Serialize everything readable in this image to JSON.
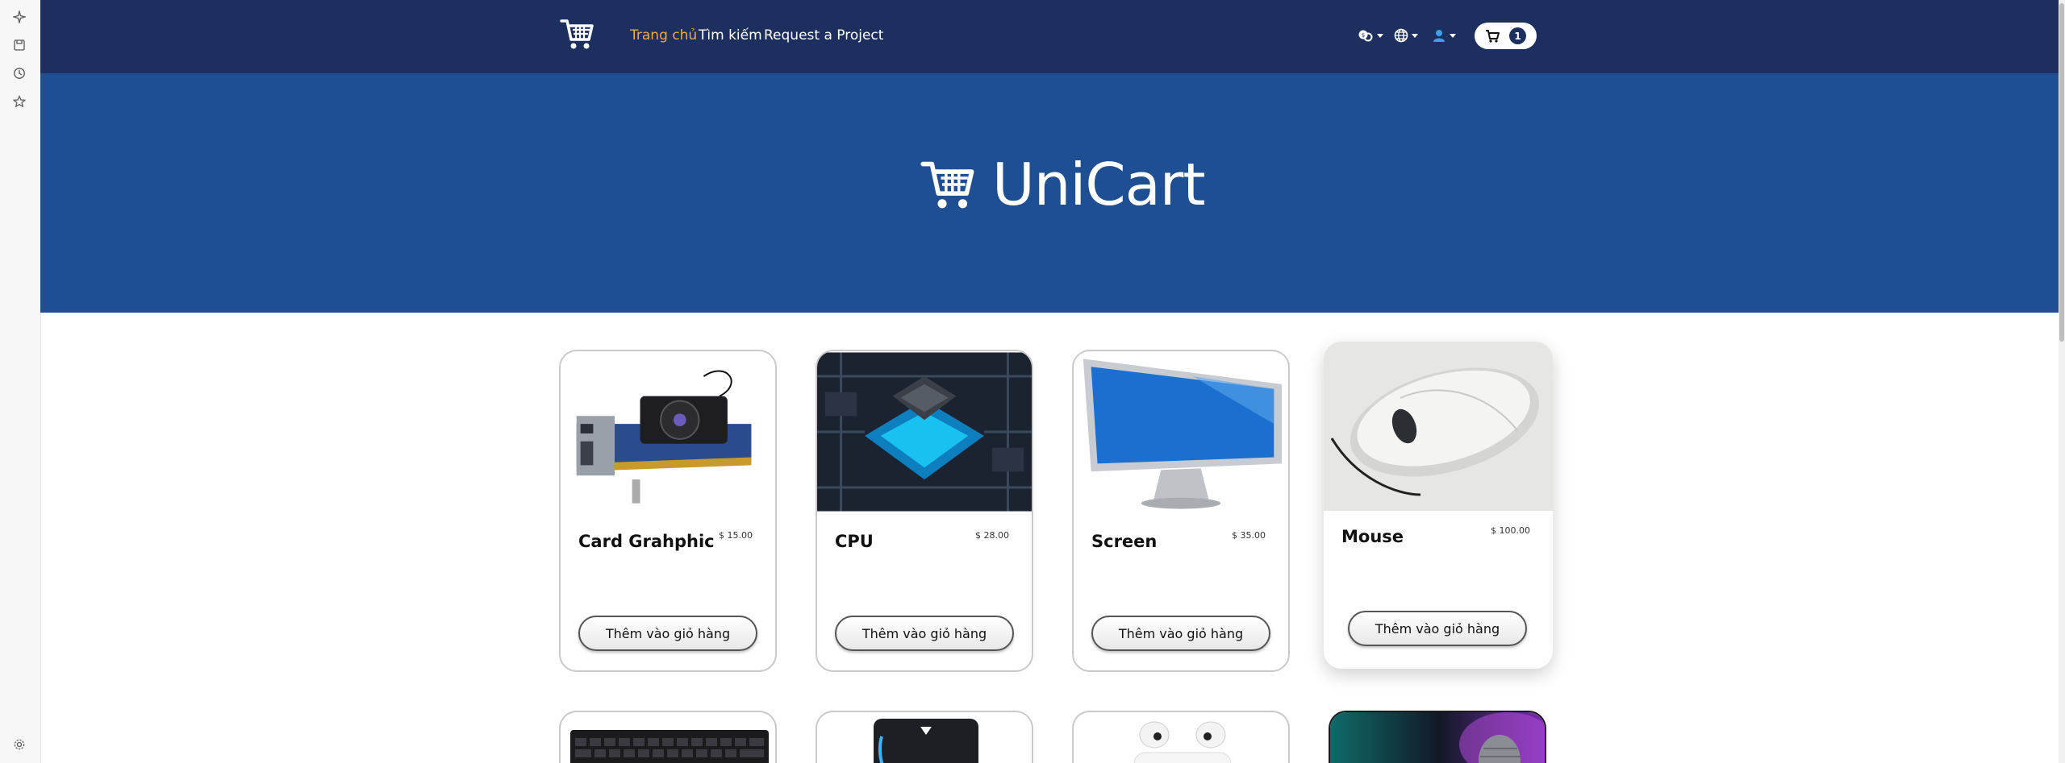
{
  "browser_rail": {
    "items": [
      {
        "icon": "sparkle-icon"
      },
      {
        "icon": "save-page-icon"
      },
      {
        "icon": "history-icon"
      },
      {
        "icon": "star-icon"
      }
    ],
    "settings_icon": "gear-icon"
  },
  "navbar": {
    "logo_icon": "cart-logo-icon",
    "links": [
      {
        "label": "Trang chủ",
        "active": true
      },
      {
        "label": "Tìm kiếm",
        "active": false
      },
      {
        "label": "Request a Project",
        "active": false
      }
    ],
    "controls": [
      {
        "icon": "currency-icon"
      },
      {
        "icon": "globe-icon"
      },
      {
        "icon": "user-icon"
      }
    ],
    "cart": {
      "icon": "cart-icon",
      "count": "1"
    }
  },
  "hero": {
    "title": "UniCart",
    "icon": "cart-logo-icon",
    "colors": {
      "navbar": "#1d2f5e",
      "hero": "#1e4f92",
      "active_link": "#f2a93b"
    }
  },
  "products": [
    {
      "name": "Card Grahphic",
      "price": "$ 15.00",
      "button": "Thêm vào giỏ hàng",
      "image": "graphics-card-image"
    },
    {
      "name": "CPU",
      "price": "$ 28.00",
      "button": "Thêm vào giỏ hàng",
      "image": "cpu-chip-image"
    },
    {
      "name": "Screen",
      "price": "$ 35.00",
      "button": "Thêm vào giỏ hàng",
      "image": "monitor-image"
    },
    {
      "name": "Mouse",
      "price": "$ 100.00",
      "button": "Thêm vào giỏ hàng",
      "image": "mouse-image"
    }
  ],
  "products_partial": [
    {
      "image": "keyboard-image"
    },
    {
      "image": "speaker-image"
    },
    {
      "image": "earbuds-image"
    },
    {
      "image": "microphone-image"
    }
  ]
}
